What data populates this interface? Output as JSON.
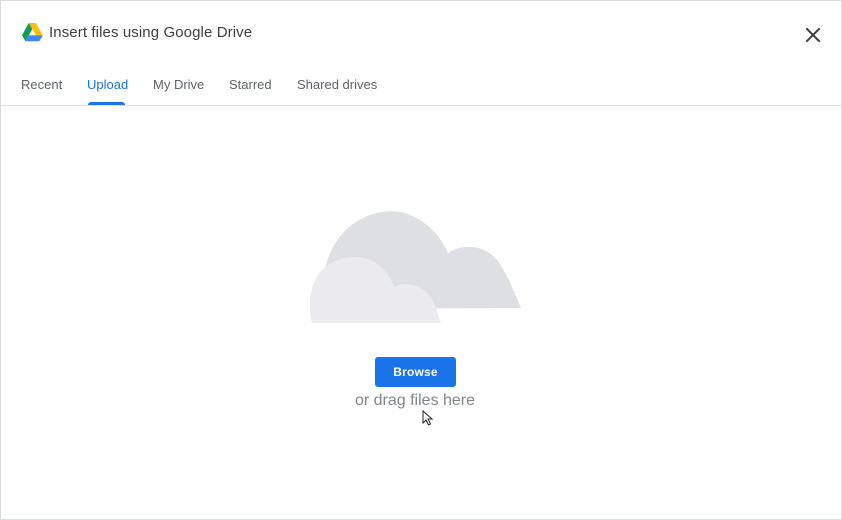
{
  "dialog": {
    "title": "Insert files using Google Drive",
    "logo_icon": "google-drive-icon",
    "close_icon": "close-icon"
  },
  "tabs": [
    {
      "label": "Recent",
      "active": false
    },
    {
      "label": "Upload",
      "active": true
    },
    {
      "label": "My Drive",
      "active": false
    },
    {
      "label": "Starred",
      "active": false
    },
    {
      "label": "Shared drives",
      "active": false
    }
  ],
  "upload": {
    "illustration_icon": "cloud-icon",
    "browse_label": "Browse",
    "drag_hint": "or drag files here"
  },
  "colors": {
    "accent": "#1a73e8",
    "title_text": "#3c4043",
    "tab_text": "#5f6368",
    "hint_text": "#80868b",
    "cloud_back": "#dedfe3",
    "cloud_front": "#ebebed"
  }
}
